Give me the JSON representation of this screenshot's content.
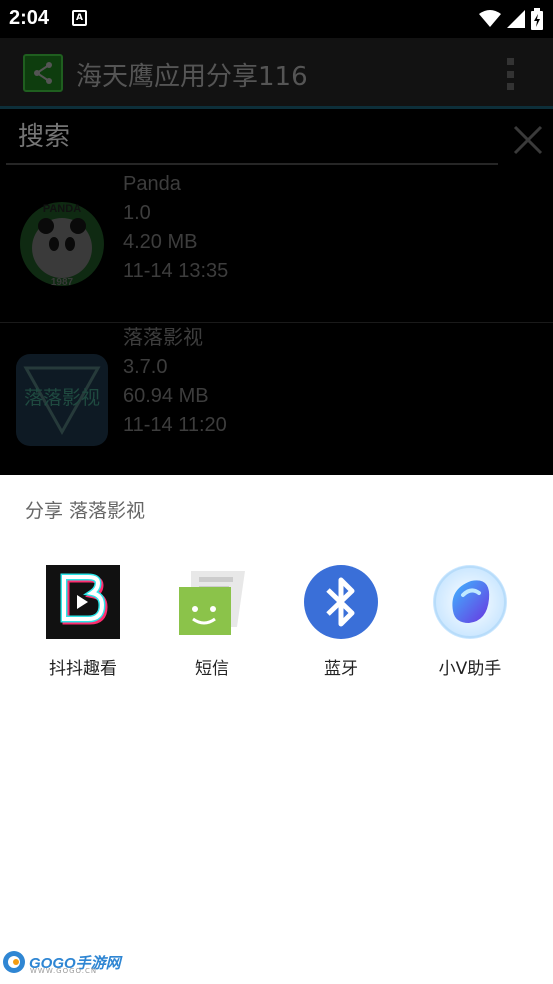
{
  "status": {
    "time": "2:04",
    "notif_letter": "A"
  },
  "app_bar": {
    "title": "海天鹰应用分享116"
  },
  "search": {
    "placeholder": "搜索"
  },
  "apps": [
    {
      "name": "Panda",
      "version": "1.0",
      "size": "4.20 MB",
      "date": "11-14 13:35",
      "icon": "panda-icon",
      "icon_text": "PANDA",
      "icon_year": "1987"
    },
    {
      "name": "落落影视",
      "version": "3.7.0",
      "size": "60.94 MB",
      "date": "11-14 11:20",
      "icon": "luoluo-icon",
      "icon_text": "落落影视"
    }
  ],
  "share": {
    "title": "分享 落落影视",
    "targets": [
      {
        "label": "抖抖趣看",
        "icon": "doudou-app-icon"
      },
      {
        "label": "短信",
        "icon": "messaging-icon"
      },
      {
        "label": "蓝牙",
        "icon": "bluetooth-icon"
      },
      {
        "label": "小V助手",
        "icon": "xiaov-assistant-icon"
      }
    ]
  },
  "watermark": {
    "brand": "GOGO手游网",
    "url": "WWW.GOGO.CN"
  },
  "colors": {
    "accent": "#0d2f3a",
    "bluetooth": "#3a6fd8",
    "messaging": "#8bc34a",
    "sheet_bg": "#ffffff"
  }
}
